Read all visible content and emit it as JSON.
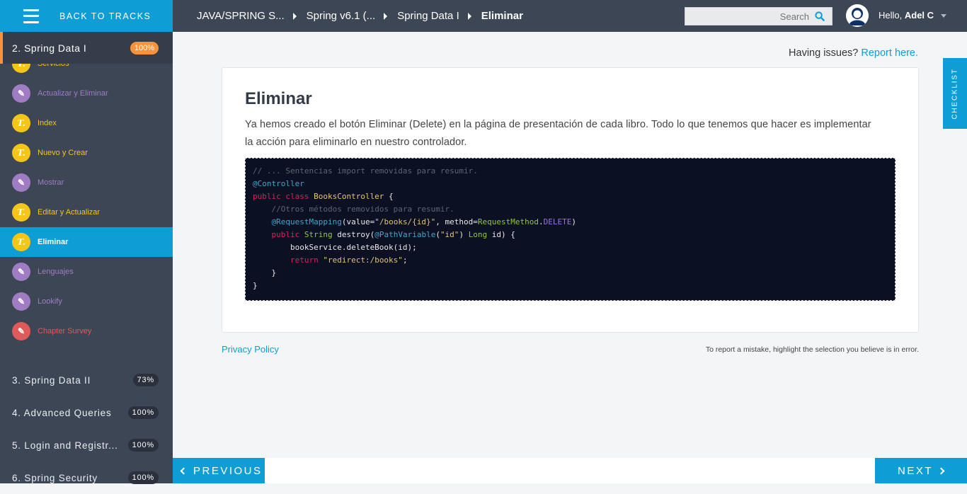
{
  "sidebar": {
    "back_label": "BACK TO TRACKS",
    "current_chapter": {
      "title": "2. Spring Data I",
      "progress": "100%"
    },
    "lessons": [
      {
        "label": "Servicios",
        "kind": "text"
      },
      {
        "label": "Actualizar y Eliminar",
        "kind": "practice"
      },
      {
        "label": "Index",
        "kind": "text"
      },
      {
        "label": "Nuevo y Crear",
        "kind": "text"
      },
      {
        "label": "Mostrar",
        "kind": "practice"
      },
      {
        "label": "Editar y Actualizar",
        "kind": "text"
      },
      {
        "label": "Eliminar",
        "kind": "text",
        "active": true
      },
      {
        "label": "Lenguajes",
        "kind": "practice"
      },
      {
        "label": "Lookify",
        "kind": "practice"
      },
      {
        "label": "Chapter Survey",
        "kind": "survey"
      }
    ],
    "chapters": [
      {
        "title": "3. Spring Data II",
        "progress": "73%"
      },
      {
        "title": "4. Advanced Queries",
        "progress": "100%"
      },
      {
        "title": "5. Login and Registr...",
        "progress": "100%"
      },
      {
        "title": "6. Spring Security",
        "progress": "100%"
      }
    ]
  },
  "header": {
    "breadcrumbs": [
      "JAVA/SPRING S...",
      "Spring v6.1 (...",
      "Spring Data I",
      "Eliminar"
    ],
    "search_placeholder": "Search",
    "greeting": "Hello,",
    "user_name": "Adel C"
  },
  "main": {
    "issues_text": "Having issues?",
    "issues_link": "Report here.",
    "title": "Eliminar",
    "body": "Ya hemos creado el botón Eliminar (Delete) en la página de presentación de cada libro. Todo lo que tenemos que hacer es implementar la acción para eliminarlo en nuestro controlador.",
    "code_lines": [
      [
        [
          "cm",
          "// ... Sentencias import removidas para resumir."
        ]
      ],
      [
        [
          "an",
          "@Controller"
        ]
      ],
      [
        [
          "kw",
          "public class "
        ],
        [
          "cl",
          "BooksController"
        ],
        [
          "tx",
          " {"
        ]
      ],
      [
        [
          "tx",
          "    "
        ],
        [
          "cm",
          "//Otros métodos removidos para resumir."
        ]
      ],
      [
        [
          "tx",
          "    "
        ],
        [
          "an",
          "@RequestMapping"
        ],
        [
          "tx",
          "(value="
        ],
        [
          "st",
          "\"/books/{id}\""
        ],
        [
          "tx",
          ", method="
        ],
        [
          "gr",
          "RequestMethod"
        ],
        [
          "tx",
          "."
        ],
        [
          "pu",
          "DELETE"
        ],
        [
          "tx",
          ")"
        ]
      ],
      [
        [
          "tx",
          "    "
        ],
        [
          "kw",
          "public "
        ],
        [
          "ty",
          "String"
        ],
        [
          "tx",
          " destroy("
        ],
        [
          "an",
          "@PathVariable"
        ],
        [
          "tx",
          "("
        ],
        [
          "st",
          "\"id\""
        ],
        [
          "tx",
          ") "
        ],
        [
          "ty",
          "Long"
        ],
        [
          "tx",
          " id) {"
        ]
      ],
      [
        [
          "tx",
          "        bookService.deleteBook(id);"
        ]
      ],
      [
        [
          "tx",
          "        "
        ],
        [
          "kw",
          "return "
        ],
        [
          "st",
          "\"redirect:/books\""
        ],
        [
          "tx",
          ";"
        ]
      ],
      [
        [
          "tx",
          "    }"
        ]
      ],
      [
        [
          "tx",
          "}"
        ]
      ]
    ],
    "privacy_label": "Privacy Policy",
    "mistake_text": "To report a mistake, highlight the selection you believe is in error."
  },
  "checklist_label": "CHECKLIST",
  "nav": {
    "previous_label": "PREVIOUS",
    "next_label": "NEXT"
  },
  "colors": {
    "accent": "#0e9ed5",
    "sidebar": "#3d4655",
    "orange": "#f8923b"
  }
}
